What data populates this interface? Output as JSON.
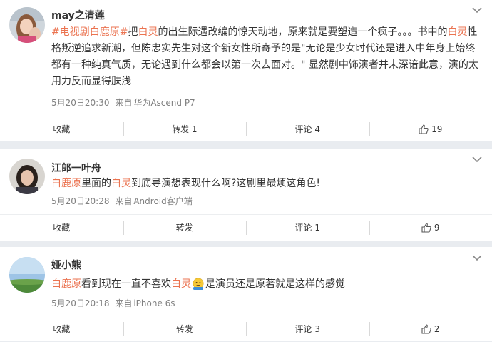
{
  "posts": [
    {
      "username": "may之清莲",
      "text": {
        "tag": "#电视剧白鹿原#",
        "p1": "把",
        "h1": "白灵",
        "p2": "的出生际遇改编的惊天动地，原来就是要塑造一个疯子。。。书中的",
        "h2": "白灵",
        "p3": "性格叛逆追求新潮，但陈忠实先生对这个新女性所寄予的是\"无论是少女时代还是进入中年身上始终都有一种纯真气质，无论遇到什么都会以第一次去面对。\" 显然剧中饰演者并未深谙此意，演的太用力反而显得肤浅"
      },
      "time": "5月20日20:30",
      "source_prefix": "来自",
      "source": "华为Ascend P7",
      "actions": {
        "collect": "收藏",
        "repost": "转发 1",
        "comment": "评论 4",
        "like": "19"
      }
    },
    {
      "username": "江郎一叶舟",
      "text": {
        "h1": "白鹿原",
        "p1": "里面的",
        "h2": "白灵",
        "p2": "到底导演想表现什么啊?这剧里最烦这角色!"
      },
      "time": "5月20日20:28",
      "source_prefix": "来自",
      "source": "Android客户端",
      "actions": {
        "collect": "收藏",
        "repost": "转发",
        "comment": "评论 1",
        "like": "9"
      }
    },
    {
      "username": "娅小熊",
      "text": {
        "h1": "白鹿原",
        "p1": "看到现在一直不喜欢",
        "h2": "白灵",
        "p2": "是演员还是原著就是这样的感觉"
      },
      "emoji": "confused-face-emoji",
      "time": "5月20日20:18",
      "source_prefix": "来自",
      "source": "iPhone 6s",
      "actions": {
        "collect": "收藏",
        "repost": "转发",
        "comment": "评论 3",
        "like": "2"
      }
    }
  ],
  "colors": {
    "highlight": "#eb7350",
    "background": "#e9ecf0",
    "meta": "#808080"
  }
}
